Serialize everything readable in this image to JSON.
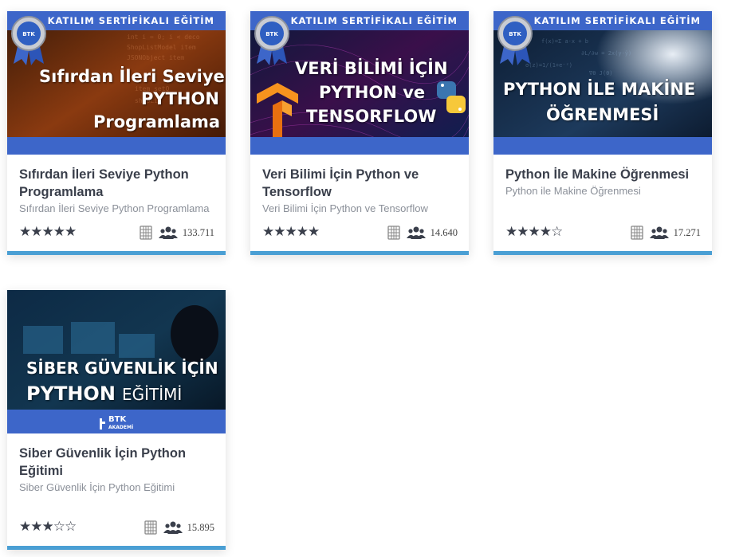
{
  "ribbon_label": "KATILIM SERTİFİKALI EĞİTİM",
  "badge_label": "BTK AKADEMİ",
  "courses": [
    {
      "image_lines": [
        "Sıfırdan İleri Seviye",
        "PYTHON",
        "Programlama"
      ],
      "title": "Sıfırdan İleri Seviye Python Programlama",
      "subtitle": "Sıfırdan İleri Seviye Python Programlama",
      "rating_stars": "★★★★★",
      "rating": 5,
      "participants": "133.711",
      "certified": true
    },
    {
      "image_lines": [
        "VERİ BİLİMİ İÇİN",
        "PYTHON ve",
        "TENSORFLOW"
      ],
      "title": "Veri Bilimi İçin Python ve Tensorflow",
      "subtitle": "Veri Bilimi İçin Python ve Tensorflow",
      "rating_stars": "★★★★★",
      "rating": 5,
      "participants": "14.640",
      "certified": true
    },
    {
      "image_lines": [
        "PYTHON İLE MAKİNE",
        "ÖĞRENMESİ"
      ],
      "title": "Python İle Makine Öğrenmesi",
      "subtitle": "Python ile Makine Öğrenmesi",
      "rating_stars": "★★★★☆",
      "rating": 4,
      "participants": "17.271",
      "certified": true
    },
    {
      "image_lines": [
        "SİBER GÜVENLİK İÇİN",
        "PYTHON",
        "EĞİTİMİ"
      ],
      "logo_text": "BTK",
      "logo_sub": "AKADEMİ",
      "title": "Siber Güvenlik İçin Python Eğitimi",
      "subtitle": "Siber Güvenlik İçin Python Eğitimi",
      "rating_stars": "★★★☆☆",
      "rating": 3,
      "participants": "15.895",
      "certified": false
    }
  ],
  "colors": {
    "ribbon": "#3d66c9",
    "accent_border": "#4a9fd4",
    "title": "#3a3f4b"
  }
}
